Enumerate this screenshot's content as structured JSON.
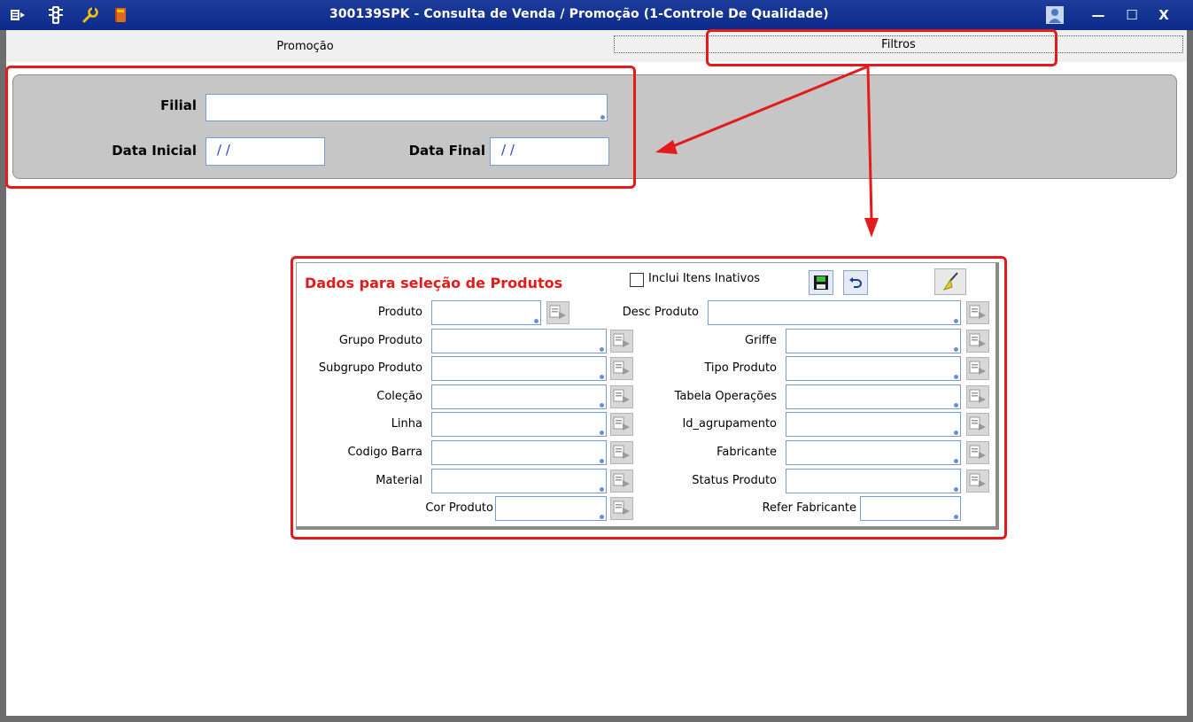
{
  "window": {
    "title": "300139SPK - Consulta de Venda / Promoção (1-Controle De Qualidade)",
    "minimize": "—",
    "maximize": "☐",
    "close": "X"
  },
  "tabs": [
    {
      "label": "Promoção"
    },
    {
      "label": "Filtros"
    }
  ],
  "filter_panel": {
    "filial_label": "Filial",
    "filial_value": "",
    "data_inicial_label": "Data Inicial",
    "data_inicial_value": "/ /",
    "data_final_label": "Data Final",
    "data_final_value": "/ /"
  },
  "product_group": {
    "title": "Dados para seleção de Produtos",
    "inclui_inativos_label": "Inclui Itens Inativos",
    "left_fields": [
      {
        "label": "Produto",
        "value": ""
      },
      {
        "label": "Grupo Produto",
        "value": ""
      },
      {
        "label": "Subgrupo Produto",
        "value": ""
      },
      {
        "label": "Coleção",
        "value": ""
      },
      {
        "label": "Linha",
        "value": ""
      },
      {
        "label": "Codigo Barra",
        "value": ""
      },
      {
        "label": "Material",
        "value": ""
      },
      {
        "label": "Cor Produto",
        "value": ""
      }
    ],
    "right_fields": [
      {
        "label": "Desc Produto",
        "value": ""
      },
      {
        "label": "Griffe",
        "value": ""
      },
      {
        "label": "Tipo Produto",
        "value": ""
      },
      {
        "label": "Tabela Operações",
        "value": ""
      },
      {
        "label": "Id_agrupamento",
        "value": ""
      },
      {
        "label": "Fabricante",
        "value": ""
      },
      {
        "label": "Status Produto",
        "value": ""
      },
      {
        "label": "Refer Fabricante",
        "value": ""
      }
    ]
  },
  "colors": {
    "titlebar": "#0b2a8a",
    "highlight": "#e31b1b",
    "panel": "#c6c6c6",
    "input_border": "#7a9ccc"
  }
}
